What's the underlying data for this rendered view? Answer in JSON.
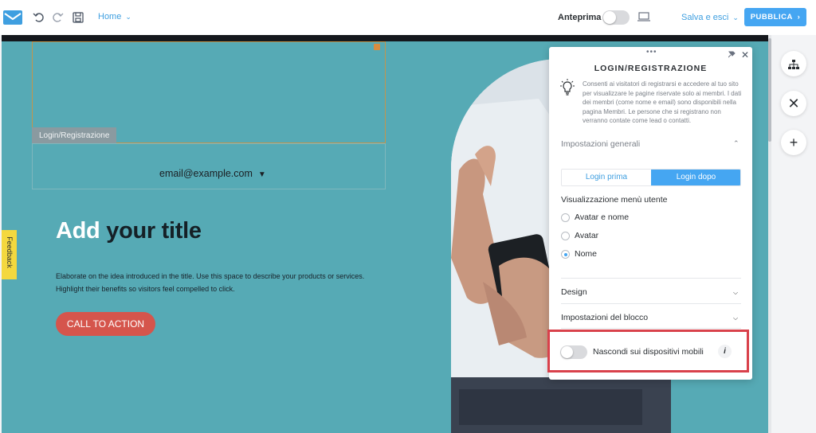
{
  "topbar": {
    "page_selector": "Home",
    "preview_label": "Anteprima",
    "preview_enabled": false,
    "save_exit_label": "Salva e esci",
    "publish_label": "PUBBLICA"
  },
  "canvas": {
    "selected_block_tag": "Login/Registrazione",
    "member_email": "email@example.com",
    "hero": {
      "title_light": "Add",
      "title_dark": "your title",
      "body_line1": "Elaborate on the idea introduced in the title. Use this space to describe your products or services.",
      "body_line2": "Highlight their benefits so visitors feel compelled to click.",
      "cta_label": "CALL TO ACTION"
    },
    "feedback_tab": "Feedback"
  },
  "side_tools": [
    "sitemap-icon",
    "close-icon",
    "add-icon"
  ],
  "panel": {
    "title": "LOGIN/REGISTRAZIONE",
    "description": "Consenti ai visitatori di registrarsi e accedere al tuo sito per visualizzare le pagine riservate solo ai membri. I dati dei membri (come nome e email) sono disponibili nella pagina Membri. Le persone che si registrano non verranno contate come lead o contatti.",
    "general_section": "Impostazioni generali",
    "login_tabs": [
      "Login prima",
      "Login dopo"
    ],
    "active_login_tab": "Login dopo",
    "user_menu_label": "Visualizzazione menù utente",
    "user_menu_options": [
      "Avatar e nome",
      "Avatar",
      "Nome"
    ],
    "user_menu_selected": "Nome",
    "design_section": "Design",
    "block_settings_section": "Impostazioni del blocco",
    "hide_mobile_label": "Nascondi sui dispositivi mobili",
    "hide_mobile_enabled": false
  },
  "colors": {
    "accent": "#45a6f2",
    "canvas_bg": "#56aab5",
    "cta": "#d5554c",
    "highlight": "#d9414b"
  }
}
